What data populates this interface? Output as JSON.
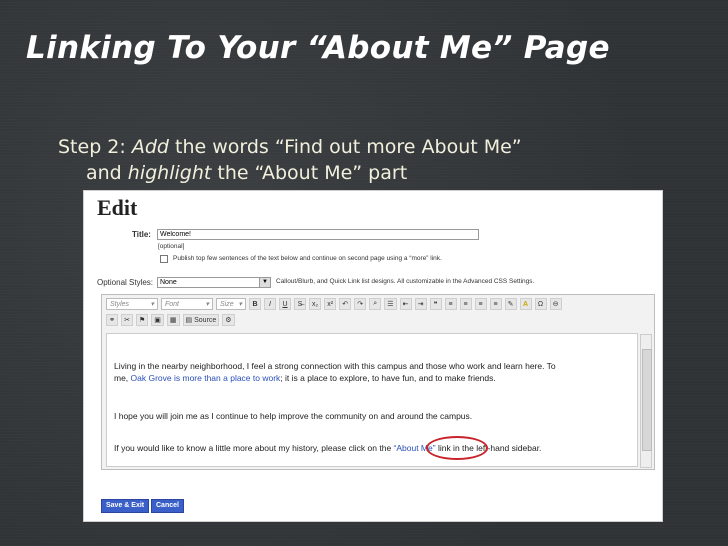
{
  "slide": {
    "title": "Linking To Your “About Me” Page",
    "step_prefix": "Step 2: ",
    "step_add": "Add",
    "step_mid": " the words “Find out more About Me”",
    "step_and": "and ",
    "step_highlight": "highlight",
    "step_end": " the “About Me” part"
  },
  "editor": {
    "heading": "Edit",
    "title_label": "Title:",
    "title_value": "Welcome!",
    "optional_note": "[optional]",
    "publish_text": "Publish top few sentences of the text below and continue on second page using a “more” link.",
    "optional_styles_label": "Optional Styles:",
    "optional_styles_value": "None",
    "styles_hint": "Callout/Blurb, and Quick Link list designs. All customizable in the Advanced CSS Settings.",
    "toolbar": {
      "styles": "Styles",
      "font": "Font",
      "size": "Size",
      "bold": "B",
      "italic": "I",
      "underline": "U",
      "source": "Source"
    },
    "para1_a": "Living in the nearby neighborhood, I feel a strong connection with this campus and those who work and learn here.  To",
    "para1_b_pre": "me, ",
    "para1_b_link": "Oak Grove is more than a place to work",
    "para1_b_post": "; it is a place to explore, to have fun, and to make friends.",
    "para2": "I hope you will join me as I continue to help improve the community on and around the campus.",
    "para3_pre": "If you would like to know a little more about my history, please click on the ",
    "para3_link": "“About Me”",
    "para3_post": " link in the left-hand sidebar.",
    "save_label": "Save & Exit",
    "cancel_label": "Cancel"
  },
  "colors": {
    "accent_circle": "#c8232b",
    "link": "#2a4fb8",
    "button": "#3a5fc8"
  }
}
